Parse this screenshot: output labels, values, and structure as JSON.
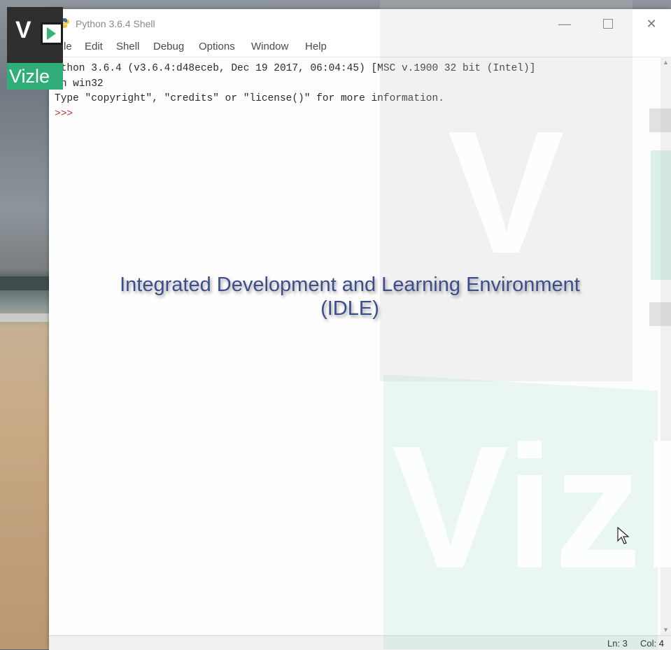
{
  "window": {
    "title": "Python 3.6.4 Shell",
    "controls": {
      "minimize": "—",
      "maximize": "",
      "close": "✕"
    }
  },
  "menu": [
    "le",
    "Edit",
    "Shell",
    "Debug",
    "Options",
    "Window",
    "Help"
  ],
  "shell": {
    "line1": "ython 3.6.4 (v3.6.4:d48eceb, Dec 19 2017, 06:04:45) [MSC v.1900 32 bit (Intel)]",
    "line2": "on win32",
    "line3": "Type \"copyright\", \"credits\" or \"license()\" for more information.",
    "prompt": ">>>"
  },
  "status": {
    "line": "Ln: 3",
    "col": "Col: 4"
  },
  "caption": {
    "line1": "Integrated Development and Learning Environment",
    "line2": "(IDLE)"
  },
  "logo": {
    "letter": "V",
    "word": "Vizle"
  },
  "watermark": {
    "big_letter": "V",
    "big_word": "Vizl"
  },
  "scroll": {
    "up": "▲",
    "down": "▼"
  },
  "colors": {
    "caption": "#3c4f8a",
    "prompt": "#c03a3a",
    "logo_green": "#2fae78",
    "logo_dark": "#2f2f2f"
  },
  "icons": [
    "python-icon",
    "minimize-icon",
    "maximize-icon",
    "close-icon",
    "mouse-cursor-icon",
    "play-icon"
  ]
}
